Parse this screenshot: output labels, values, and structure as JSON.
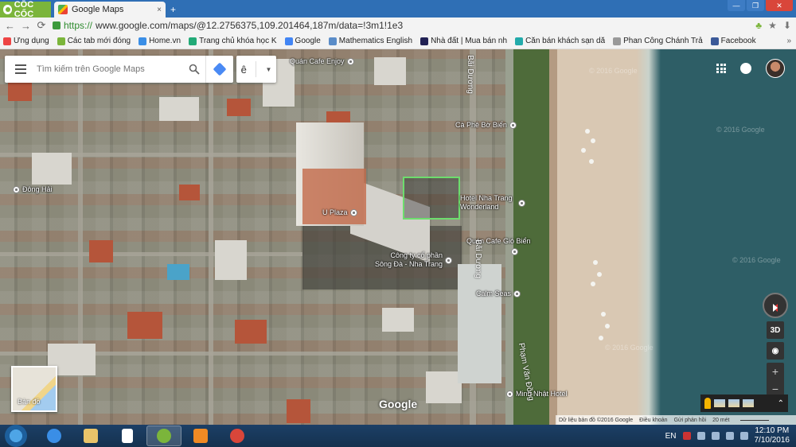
{
  "browser": {
    "brand": "CỐC CỐC",
    "tab_title": "Google Maps",
    "tab_close": "×",
    "new_tab": "+",
    "url_protocol": "https://",
    "url_rest": "www.google.com/maps/@12.2756375,109.201464,187m/data=!3m1!1e3",
    "back": "←",
    "forward": "→",
    "reload": "⟳",
    "download": "⬇",
    "star": "★",
    "leaf": "♣",
    "win_minimize": "—",
    "win_maximize": "❐",
    "win_close": "✕"
  },
  "bookmarks": [
    {
      "label": "Ứng dụng",
      "color": "#e44"
    },
    {
      "label": "Các tab mới đóng",
      "color": "#7bb53b"
    },
    {
      "label": "Home.vn",
      "color": "#3a8ee6"
    },
    {
      "label": "Trang chủ khóa học K",
      "color": "#2a7"
    },
    {
      "label": "Google",
      "color": "#4285f4"
    },
    {
      "label": "Mathematics English",
      "color": "#5a8cc8"
    },
    {
      "label": "Nhà đất | Mua bán nh",
      "color": "#225"
    },
    {
      "label": "Căn bán khách sạn dă",
      "color": "#2aa"
    },
    {
      "label": "Phan Công Chánh Trả",
      "color": "#999"
    },
    {
      "label": "Facebook",
      "color": "#3b5998"
    }
  ],
  "bookmarks_more": "»",
  "maps": {
    "search_placeholder": "Tìm kiếm trên Google Maps",
    "lang_label": "ê",
    "lang_caret": "▼",
    "google_logo": "Google",
    "minimap_label": "Bản đồ",
    "btn_3d": "3D",
    "btn_locate": "◉",
    "zoom_in": "+",
    "zoom_out": "−",
    "sv_chevron": "⌃",
    "attribution": {
      "data": "Dữ liệu bản đồ ©2016 Google",
      "terms": "Điều khoản",
      "feedback": "Gửi phản hồi",
      "scale": "20 mét"
    }
  },
  "places": {
    "quan_cafe_enjoy": "Quán Cafe Enjoy",
    "ca_phe_bo_bien": "Cà Phê Bờ Biển",
    "dong_hai": "Đông Hải",
    "u_plaza": "U Plaza",
    "hotel_nha_trang": "Hotel Nha Trang Wonderland",
    "quan_cafe_gio_bien": "Quán Cafe Gió Biển",
    "cong_ty": "Công ty cổ phần Sông Đà - Nha Trang",
    "calm_seas": "Calm Seas",
    "minh_nhat": "Minh Nhật Hotel",
    "road_bai_duong_1": "Bãi Dương",
    "road_bai_duong_2": "Bãi Dương",
    "road_pham_van_dong": "Phạm Văn Đồng"
  },
  "watermarks": {
    "w1": "© 2016 Google",
    "w2": "© 2016 Google",
    "w3": "© 2016 Google",
    "w4": "© 2016 Google"
  },
  "taskbar": {
    "lang": "EN",
    "time": "12:10 PM",
    "date": "7/10/2016"
  },
  "colors": {
    "selection": "#6ddd6d",
    "chrome_blue": "#2f6fb5",
    "coccoc_green": "#7bb53b"
  }
}
